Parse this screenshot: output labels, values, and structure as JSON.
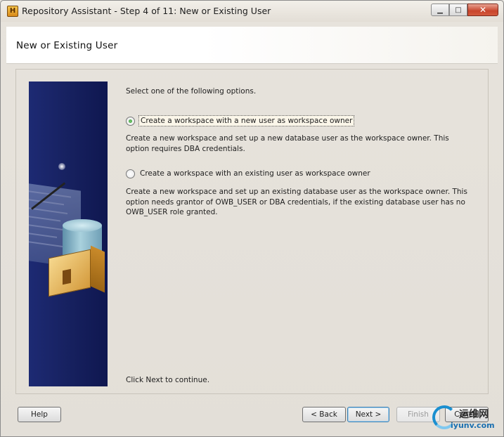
{
  "window": {
    "title": "Repository Assistant - Step 4 of 11: New or Existing User",
    "icon_glyph": "H",
    "minimize_glyph": "▁",
    "maximize_glyph": "□",
    "close_glyph": "✕"
  },
  "header": {
    "title": "New or Existing User"
  },
  "content": {
    "intro": "Select one of the following options.",
    "options": [
      {
        "label": "Create a workspace with a new user as workspace owner",
        "selected": true,
        "description_lines": [
          "Create a new workspace and set up a new database user as the workspace owner. This",
          "option requires DBA credentials."
        ]
      },
      {
        "label": "Create a workspace with an existing user as workspace owner",
        "selected": false,
        "description_lines": [
          "Create a new workspace and set up an existing database user as the workspace owner. This",
          "option needs grantor of OWB_USER or DBA credentials, if the existing database user has no",
          "OWB_USER role granted."
        ]
      }
    ],
    "footer_note": "Click Next to continue."
  },
  "buttons": {
    "help": "Help",
    "back": "< Back",
    "next": "Next >",
    "finish": "Finish",
    "cancel": "Cancel"
  },
  "watermark": {
    "chinese_text": "运维网",
    "url_text": "iyunv.com"
  },
  "colors": {
    "art_background": "#1d2a73",
    "radio_selected": "#2f8f2a",
    "default_button_border": "#3c7fb1"
  }
}
